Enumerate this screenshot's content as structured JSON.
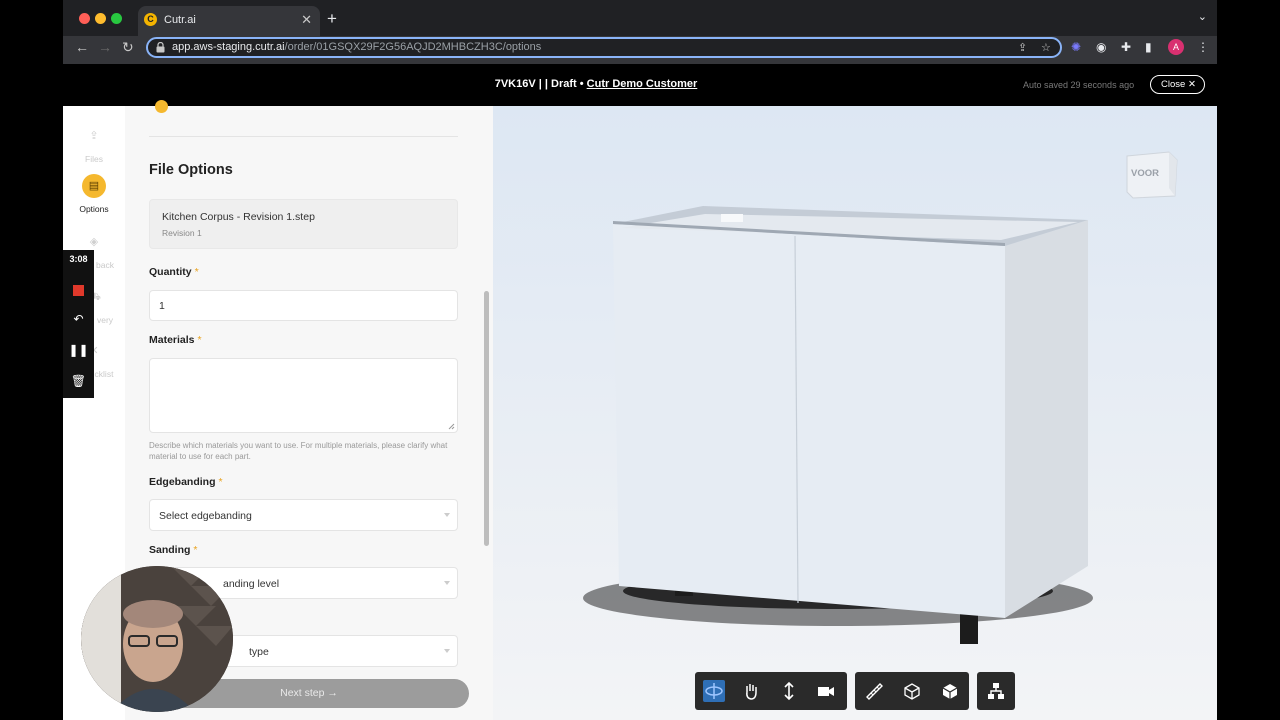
{
  "browser": {
    "tab_title": "Cutr.ai",
    "tab_favicon": "C",
    "url_host": "app.aws-staging.cutr.ai",
    "url_path": "/order/01GSQX29F2G56AQJD2MHBCZH3C/options",
    "profile_initial": "A"
  },
  "header": {
    "order_info": "7VK16V | | Draft • ",
    "customer": "Cutr Demo Customer",
    "saved_status": "Auto saved 29 seconds ago",
    "close_label": "Close"
  },
  "sidebar": {
    "items": [
      {
        "label": "Files",
        "icon": "file-upload-icon"
      },
      {
        "label": "Options",
        "icon": "options-doc-icon"
      },
      {
        "label": "back",
        "icon": "layers-icon"
      },
      {
        "label": "very",
        "icon": "delivery-icon"
      },
      {
        "label": "cklist",
        "icon": "checklist-icon"
      }
    ]
  },
  "recorder": {
    "time": "3:08"
  },
  "form": {
    "section_title": "File Options",
    "file_name": "Kitchen Corpus - Revision 1.step",
    "file_revision": "Revision 1",
    "quantity_label": "Quantity",
    "quantity_value": "1",
    "materials_label": "Materials",
    "materials_help": "Describe which materials you want to use. For multiple materials, please clarify what material to use for each part.",
    "edgebanding_label": "Edgebanding",
    "edgebanding_value": "Select edgebanding",
    "sanding_label": "Sanding",
    "sanding_value": "anding level",
    "next_select_value": "type",
    "required_mark": "*",
    "next_label": "Next step →"
  },
  "viewer": {
    "navcube_label": "VOOR",
    "tools": [
      "orbit-icon",
      "pan-icon",
      "zoom-icon",
      "camera-icon",
      "measure-icon",
      "explode-icon",
      "section-box-icon",
      "model-tree-icon"
    ]
  },
  "colors": {
    "accent": "#f5b82e",
    "tool_active": "#2f6fb6"
  }
}
